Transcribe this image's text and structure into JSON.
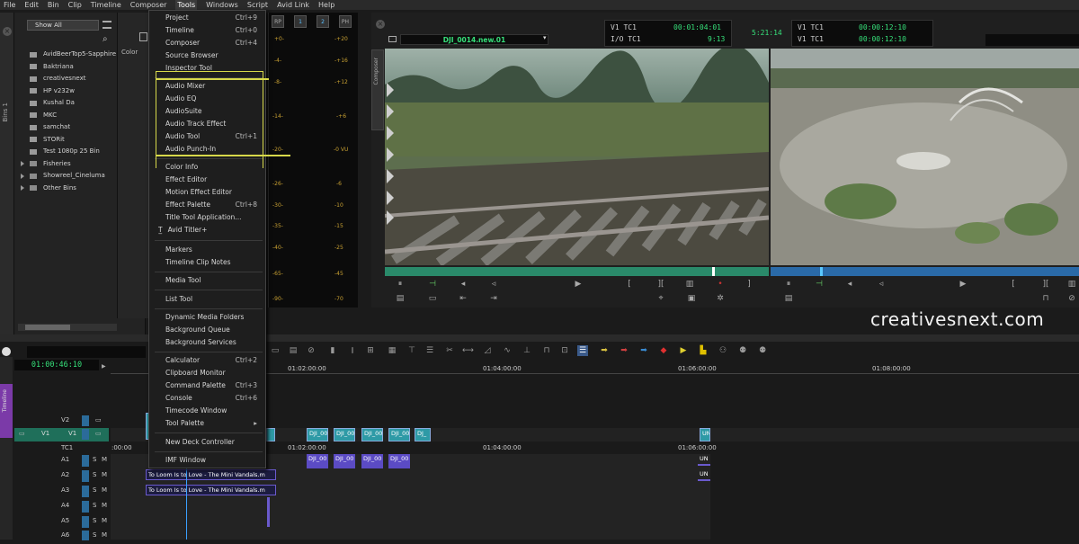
{
  "menubar": {
    "items": [
      "File",
      "Edit",
      "Bin",
      "Clip",
      "Timeline",
      "Composer",
      "Tools",
      "Windows",
      "Script",
      "Avid Link",
      "Help"
    ],
    "active": "Tools"
  },
  "bin": {
    "side_label": "Bins 1",
    "dropdown": "Show All",
    "items": [
      {
        "label": "AvidBeerTop5-Sapphire",
        "type": "bin"
      },
      {
        "label": "Baktriana",
        "type": "bin"
      },
      {
        "label": "creativesnext",
        "type": "bin"
      },
      {
        "label": "HP v232w",
        "type": "bin"
      },
      {
        "label": "Kushal Da",
        "type": "bin"
      },
      {
        "label": "MKC",
        "type": "bin"
      },
      {
        "label": "samchat",
        "type": "bin"
      },
      {
        "label": "STORit",
        "type": "bin"
      },
      {
        "label": "Test 1080p 25 Bin",
        "type": "bin"
      },
      {
        "label": "Fisheries",
        "type": "folder"
      },
      {
        "label": "Showreel_Cineluma",
        "type": "folder"
      },
      {
        "label": "Other Bins",
        "type": "folder"
      }
    ],
    "color_column_label": "Color"
  },
  "tools_menu": {
    "items": [
      {
        "label": "Project",
        "shortcut": "Ctrl+9"
      },
      {
        "label": "Timeline",
        "shortcut": "Ctrl+0"
      },
      {
        "label": "Composer",
        "shortcut": "Ctrl+4"
      },
      {
        "label": "Source Browser",
        "shortcut": ""
      },
      {
        "label": "Inspector Tool",
        "shortcut": ""
      },
      {
        "label": "Audio Mixer",
        "shortcut": ""
      },
      {
        "label": "Audio EQ",
        "shortcut": ""
      },
      {
        "label": "AudioSuite",
        "shortcut": ""
      },
      {
        "label": "Audio Track Effect",
        "shortcut": ""
      },
      {
        "label": "Audio Tool",
        "shortcut": "Ctrl+1"
      },
      {
        "label": "Audio Punch-In",
        "shortcut": ""
      },
      {
        "label": "Color Info",
        "shortcut": ""
      },
      {
        "label": "Effect Editor",
        "shortcut": ""
      },
      {
        "label": "Motion Effect Editor",
        "shortcut": ""
      },
      {
        "label": "Effect Palette",
        "shortcut": "Ctrl+8"
      },
      {
        "label": "Title Tool Application...",
        "shortcut": ""
      },
      {
        "label": "Avid Titler+",
        "shortcut": ""
      },
      {
        "label": "Markers",
        "shortcut": ""
      },
      {
        "label": "Timeline Clip Notes",
        "shortcut": ""
      },
      {
        "label": "Media Tool",
        "shortcut": ""
      },
      {
        "label": "List Tool",
        "shortcut": ""
      },
      {
        "label": "Dynamic Media Folders",
        "shortcut": ""
      },
      {
        "label": "Background Queue",
        "shortcut": ""
      },
      {
        "label": "Background Services",
        "shortcut": ""
      },
      {
        "label": "Calculator",
        "shortcut": "Ctrl+2"
      },
      {
        "label": "Clipboard Monitor",
        "shortcut": ""
      },
      {
        "label": "Command Palette",
        "shortcut": "Ctrl+3"
      },
      {
        "label": "Console",
        "shortcut": "Ctrl+6"
      },
      {
        "label": "Timecode Window",
        "shortcut": ""
      },
      {
        "label": "Tool Palette",
        "shortcut": "▸"
      },
      {
        "label": "New Deck Controller",
        "shortcut": ""
      },
      {
        "label": "IMF Window",
        "shortcut": ""
      }
    ]
  },
  "meter": {
    "headers": [
      "RP",
      "1",
      "2",
      "PH"
    ],
    "left_ticks": [
      "+0-",
      "-4-",
      "-8-",
      "-14-",
      "-20-",
      "-26-",
      "-30-",
      "-35-",
      "-40-",
      "-65-",
      "-90-"
    ],
    "right_ticks": [
      "-+20",
      "-+16",
      "-+12",
      "-+6",
      "-0 VU",
      "-6",
      "-10",
      "-15",
      "-25",
      "-45",
      "-70"
    ]
  },
  "composer": {
    "side_label": "Composer",
    "clip_name": "DJI_0014.new.01",
    "src_tc": [
      {
        "label": "V1  TC1",
        "value": "00:01:04:01"
      },
      {
        "label": "I/O TC1",
        "value": "9:13"
      }
    ],
    "center_tc": "5:21:14",
    "rec_tc": [
      {
        "label": "V1  TC1",
        "value": "00:00:12:10"
      },
      {
        "label": "V1  TC1",
        "value": "00:00:12:10"
      }
    ]
  },
  "watermark": "creativesnext.com",
  "timeline": {
    "side_label": "Timeline",
    "timecode": "01:00:46:10",
    "ruler_top": [
      "01:02:00:00",
      "01:04:00:00",
      "01:06:00:00",
      "01:08:00:00"
    ],
    "ruler_track": [
      ":00:00",
      "01:02:00:00",
      "01:04:00:00",
      "01:06:00:00"
    ],
    "tracks": [
      "V2",
      "V1",
      "TC1",
      "A1",
      "A2",
      "A3",
      "A4",
      "A5",
      "A6"
    ],
    "video_clips": [
      "DJI_00",
      "DJI_00",
      "DJI_00",
      "DJI_00",
      "DJ_",
      "UN"
    ],
    "audio_clip_label": "To Loom Is to Love - The Mini Vandals.m",
    "audio_clip_un": "UN"
  }
}
